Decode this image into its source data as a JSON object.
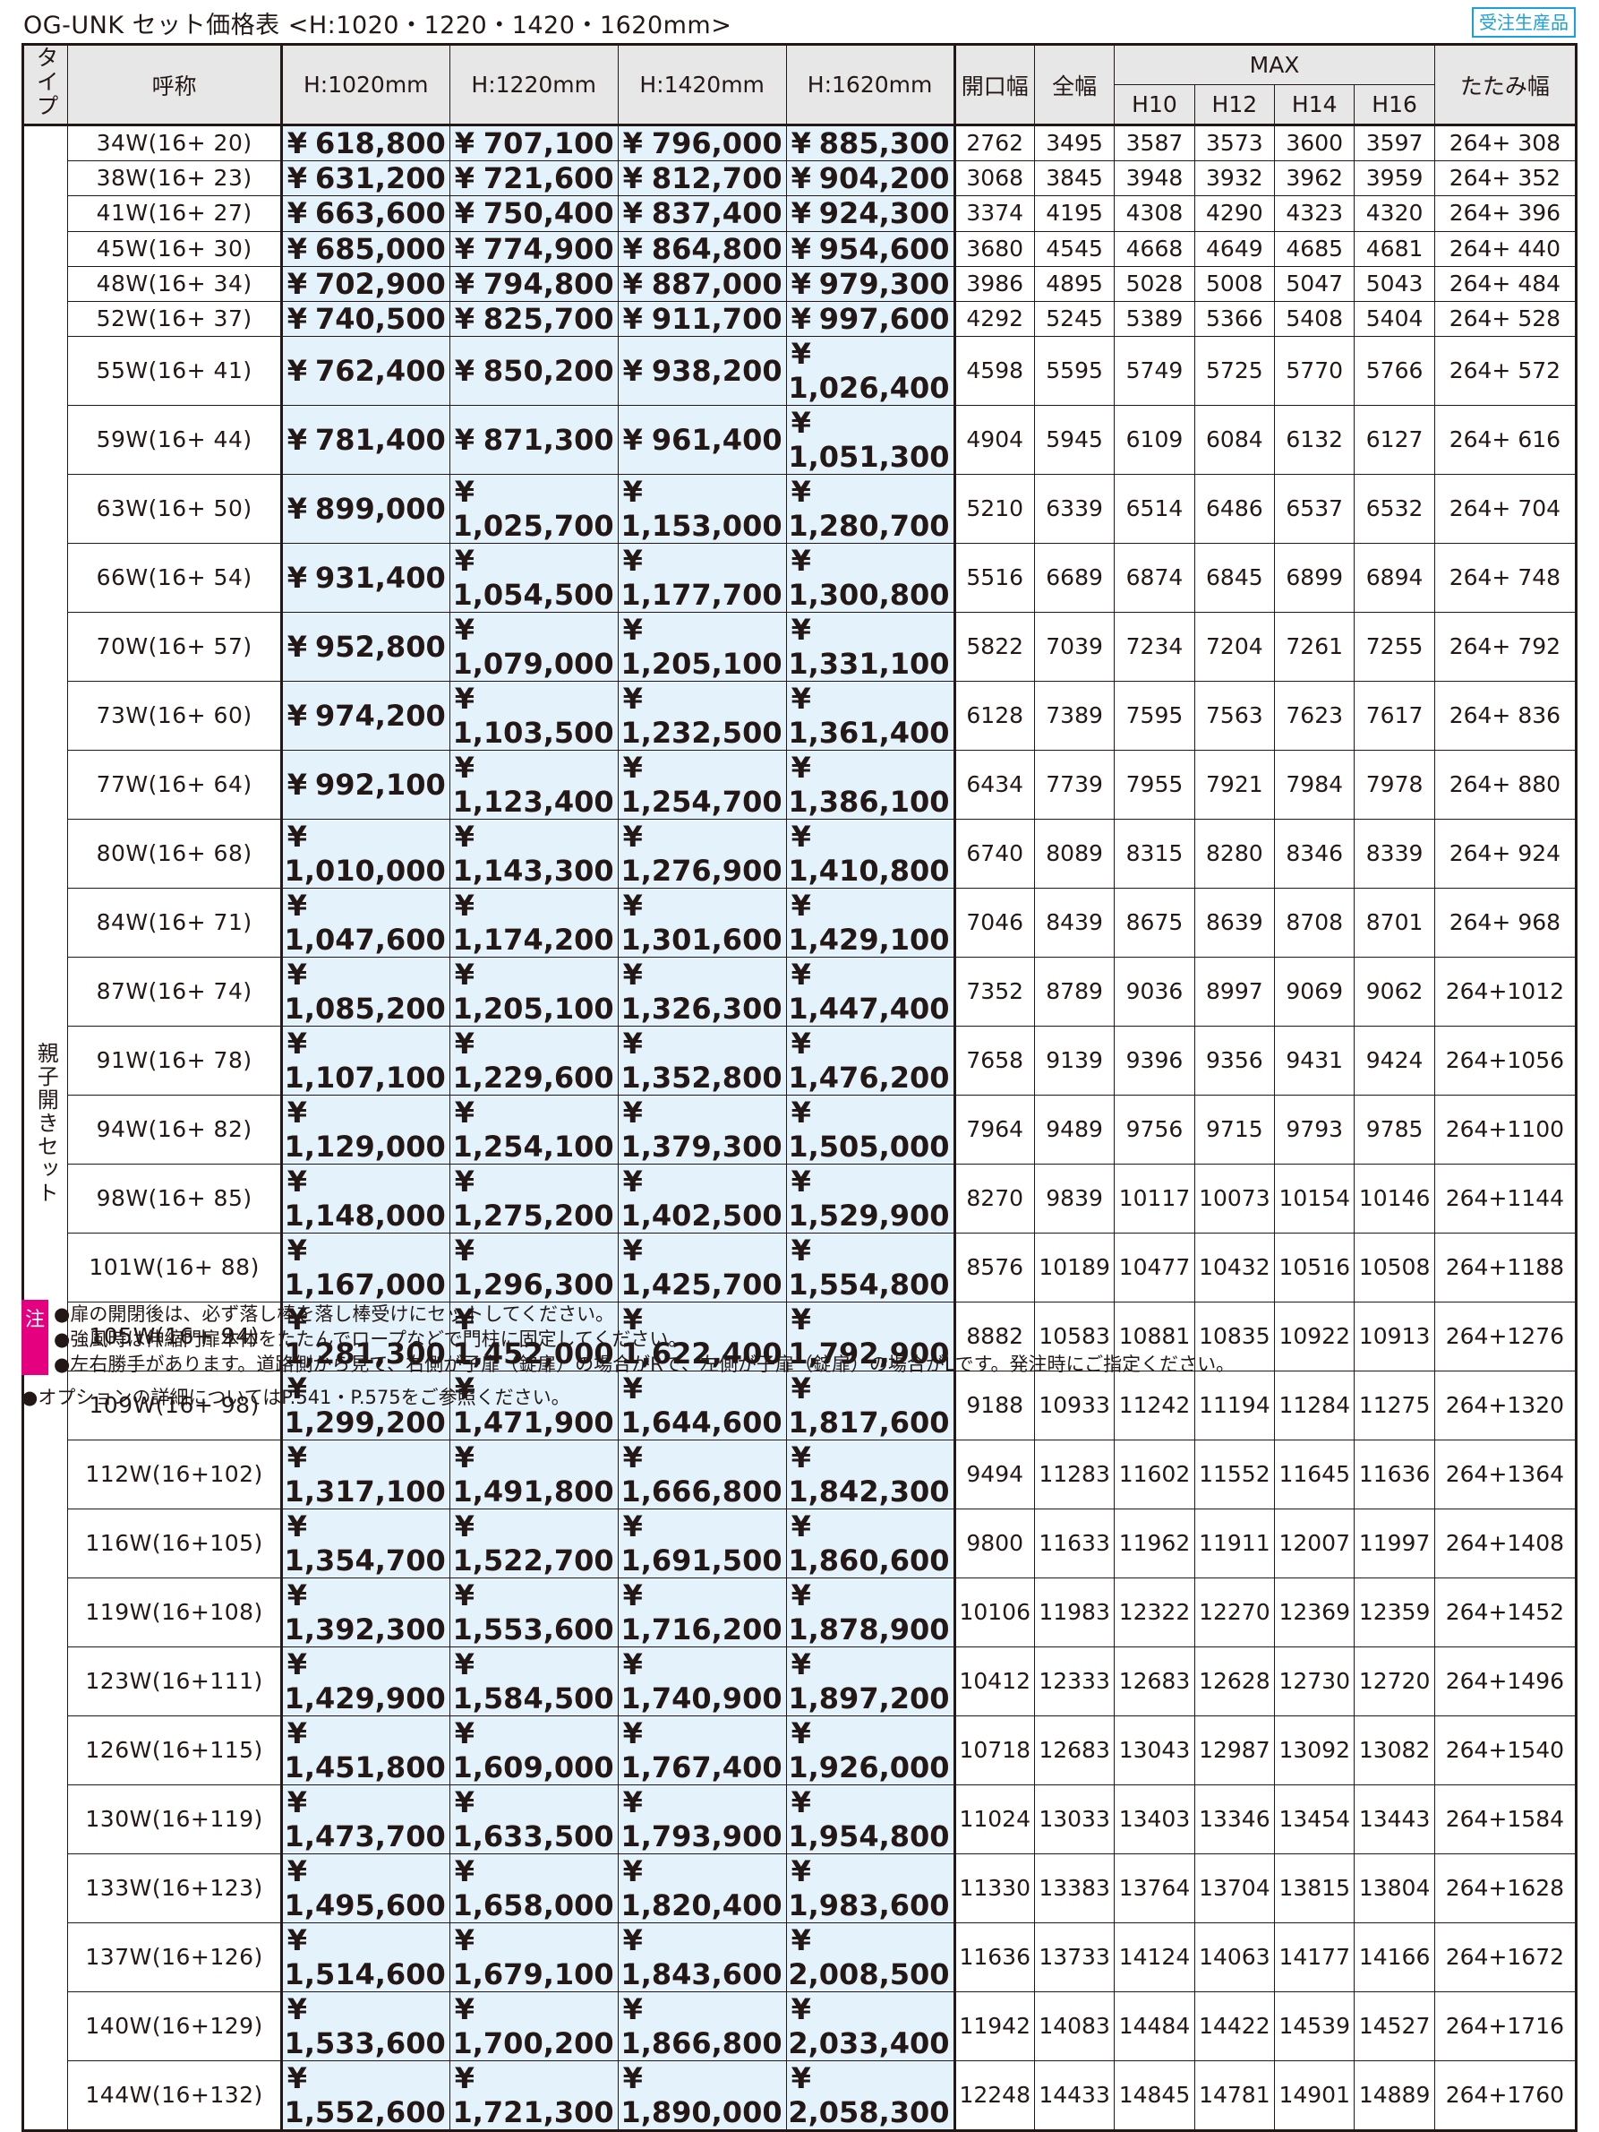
{
  "title": "OG-UNK セット価格表 <H:1020・1220・1420・1620mm>",
  "badge": "受注生産品",
  "headers": {
    "type": "タイプ",
    "name": "呼称",
    "h1020": "H:1020mm",
    "h1220": "H:1220mm",
    "h1420": "H:1420mm",
    "h1620": "H:1620mm",
    "opening": "開口幅",
    "total": "全幅",
    "max": "MAX",
    "max_sub": [
      "H10",
      "H12",
      "H14",
      "H16"
    ],
    "folded": "たたみ幅"
  },
  "type_label": "親子開きセット",
  "yen": "¥",
  "rows": [
    {
      "name": "34W(16+ 20)",
      "prices": [
        "618,800",
        "707,100",
        "796,000",
        "885,300"
      ],
      "opening": "2762",
      "total": "3495",
      "max": [
        "3587",
        "3573",
        "3600",
        "3597"
      ],
      "folded": "264+ 308"
    },
    {
      "name": "38W(16+ 23)",
      "prices": [
        "631,200",
        "721,600",
        "812,700",
        "904,200"
      ],
      "opening": "3068",
      "total": "3845",
      "max": [
        "3948",
        "3932",
        "3962",
        "3959"
      ],
      "folded": "264+ 352"
    },
    {
      "name": "41W(16+ 27)",
      "prices": [
        "663,600",
        "750,400",
        "837,400",
        "924,300"
      ],
      "opening": "3374",
      "total": "4195",
      "max": [
        "4308",
        "4290",
        "4323",
        "4320"
      ],
      "folded": "264+ 396"
    },
    {
      "name": "45W(16+ 30)",
      "prices": [
        "685,000",
        "774,900",
        "864,800",
        "954,600"
      ],
      "opening": "3680",
      "total": "4545",
      "max": [
        "4668",
        "4649",
        "4685",
        "4681"
      ],
      "folded": "264+ 440"
    },
    {
      "name": "48W(16+ 34)",
      "prices": [
        "702,900",
        "794,800",
        "887,000",
        "979,300"
      ],
      "opening": "3986",
      "total": "4895",
      "max": [
        "5028",
        "5008",
        "5047",
        "5043"
      ],
      "folded": "264+ 484"
    },
    {
      "name": "52W(16+ 37)",
      "prices": [
        "740,500",
        "825,700",
        "911,700",
        "997,600"
      ],
      "opening": "4292",
      "total": "5245",
      "max": [
        "5389",
        "5366",
        "5408",
        "5404"
      ],
      "folded": "264+ 528"
    },
    {
      "name": "55W(16+ 41)",
      "prices": [
        "762,400",
        "850,200",
        "938,200",
        "1,026,400"
      ],
      "opening": "4598",
      "total": "5595",
      "max": [
        "5749",
        "5725",
        "5770",
        "5766"
      ],
      "folded": "264+ 572"
    },
    {
      "name": "59W(16+ 44)",
      "prices": [
        "781,400",
        "871,300",
        "961,400",
        "1,051,300"
      ],
      "opening": "4904",
      "total": "5945",
      "max": [
        "6109",
        "6084",
        "6132",
        "6127"
      ],
      "folded": "264+ 616"
    },
    {
      "name": "63W(16+ 50)",
      "prices": [
        "899,000",
        "1,025,700",
        "1,153,000",
        "1,280,700"
      ],
      "opening": "5210",
      "total": "6339",
      "max": [
        "6514",
        "6486",
        "6537",
        "6532"
      ],
      "folded": "264+ 704"
    },
    {
      "name": "66W(16+ 54)",
      "prices": [
        "931,400",
        "1,054,500",
        "1,177,700",
        "1,300,800"
      ],
      "opening": "5516",
      "total": "6689",
      "max": [
        "6874",
        "6845",
        "6899",
        "6894"
      ],
      "folded": "264+ 748"
    },
    {
      "name": "70W(16+ 57)",
      "prices": [
        "952,800",
        "1,079,000",
        "1,205,100",
        "1,331,100"
      ],
      "opening": "5822",
      "total": "7039",
      "max": [
        "7234",
        "7204",
        "7261",
        "7255"
      ],
      "folded": "264+ 792"
    },
    {
      "name": "73W(16+ 60)",
      "prices": [
        "974,200",
        "1,103,500",
        "1,232,500",
        "1,361,400"
      ],
      "opening": "6128",
      "total": "7389",
      "max": [
        "7595",
        "7563",
        "7623",
        "7617"
      ],
      "folded": "264+ 836"
    },
    {
      "name": "77W(16+ 64)",
      "prices": [
        "992,100",
        "1,123,400",
        "1,254,700",
        "1,386,100"
      ],
      "opening": "6434",
      "total": "7739",
      "max": [
        "7955",
        "7921",
        "7984",
        "7978"
      ],
      "folded": "264+ 880"
    },
    {
      "name": "80W(16+ 68)",
      "prices": [
        "1,010,000",
        "1,143,300",
        "1,276,900",
        "1,410,800"
      ],
      "opening": "6740",
      "total": "8089",
      "max": [
        "8315",
        "8280",
        "8346",
        "8339"
      ],
      "folded": "264+ 924"
    },
    {
      "name": "84W(16+ 71)",
      "prices": [
        "1,047,600",
        "1,174,200",
        "1,301,600",
        "1,429,100"
      ],
      "opening": "7046",
      "total": "8439",
      "max": [
        "8675",
        "8639",
        "8708",
        "8701"
      ],
      "folded": "264+ 968"
    },
    {
      "name": "87W(16+ 74)",
      "prices": [
        "1,085,200",
        "1,205,100",
        "1,326,300",
        "1,447,400"
      ],
      "opening": "7352",
      "total": "8789",
      "max": [
        "9036",
        "8997",
        "9069",
        "9062"
      ],
      "folded": "264+1012"
    },
    {
      "name": "91W(16+ 78)",
      "prices": [
        "1,107,100",
        "1,229,600",
        "1,352,800",
        "1,476,200"
      ],
      "opening": "7658",
      "total": "9139",
      "max": [
        "9396",
        "9356",
        "9431",
        "9424"
      ],
      "folded": "264+1056"
    },
    {
      "name": "94W(16+ 82)",
      "prices": [
        "1,129,000",
        "1,254,100",
        "1,379,300",
        "1,505,000"
      ],
      "opening": "7964",
      "total": "9489",
      "max": [
        "9756",
        "9715",
        "9793",
        "9785"
      ],
      "folded": "264+1100"
    },
    {
      "name": "98W(16+ 85)",
      "prices": [
        "1,148,000",
        "1,275,200",
        "1,402,500",
        "1,529,900"
      ],
      "opening": "8270",
      "total": "9839",
      "max": [
        "10117",
        "10073",
        "10154",
        "10146"
      ],
      "folded": "264+1144"
    },
    {
      "name": "101W(16+ 88)",
      "prices": [
        "1,167,000",
        "1,296,300",
        "1,425,700",
        "1,554,800"
      ],
      "opening": "8576",
      "total": "10189",
      "max": [
        "10477",
        "10432",
        "10516",
        "10508"
      ],
      "folded": "264+1188"
    },
    {
      "name": "105W(16+ 94)",
      "prices": [
        "1,281,300",
        "1,452,000",
        "1,622,400",
        "1,792,900"
      ],
      "opening": "8882",
      "total": "10583",
      "max": [
        "10881",
        "10835",
        "10922",
        "10913"
      ],
      "folded": "264+1276"
    },
    {
      "name": "109W(16+ 98)",
      "prices": [
        "1,299,200",
        "1,471,900",
        "1,644,600",
        "1,817,600"
      ],
      "opening": "9188",
      "total": "10933",
      "max": [
        "11242",
        "11194",
        "11284",
        "11275"
      ],
      "folded": "264+1320"
    },
    {
      "name": "112W(16+102)",
      "prices": [
        "1,317,100",
        "1,491,800",
        "1,666,800",
        "1,842,300"
      ],
      "opening": "9494",
      "total": "11283",
      "max": [
        "11602",
        "11552",
        "11645",
        "11636"
      ],
      "folded": "264+1364"
    },
    {
      "name": "116W(16+105)",
      "prices": [
        "1,354,700",
        "1,522,700",
        "1,691,500",
        "1,860,600"
      ],
      "opening": "9800",
      "total": "11633",
      "max": [
        "11962",
        "11911",
        "12007",
        "11997"
      ],
      "folded": "264+1408"
    },
    {
      "name": "119W(16+108)",
      "prices": [
        "1,392,300",
        "1,553,600",
        "1,716,200",
        "1,878,900"
      ],
      "opening": "10106",
      "total": "11983",
      "max": [
        "12322",
        "12270",
        "12369",
        "12359"
      ],
      "folded": "264+1452"
    },
    {
      "name": "123W(16+111)",
      "prices": [
        "1,429,900",
        "1,584,500",
        "1,740,900",
        "1,897,200"
      ],
      "opening": "10412",
      "total": "12333",
      "max": [
        "12683",
        "12628",
        "12730",
        "12720"
      ],
      "folded": "264+1496"
    },
    {
      "name": "126W(16+115)",
      "prices": [
        "1,451,800",
        "1,609,000",
        "1,767,400",
        "1,926,000"
      ],
      "opening": "10718",
      "total": "12683",
      "max": [
        "13043",
        "12987",
        "13092",
        "13082"
      ],
      "folded": "264+1540"
    },
    {
      "name": "130W(16+119)",
      "prices": [
        "1,473,700",
        "1,633,500",
        "1,793,900",
        "1,954,800"
      ],
      "opening": "11024",
      "total": "13033",
      "max": [
        "13403",
        "13346",
        "13454",
        "13443"
      ],
      "folded": "264+1584"
    },
    {
      "name": "133W(16+123)",
      "prices": [
        "1,495,600",
        "1,658,000",
        "1,820,400",
        "1,983,600"
      ],
      "opening": "11330",
      "total": "13383",
      "max": [
        "13764",
        "13704",
        "13815",
        "13804"
      ],
      "folded": "264+1628"
    },
    {
      "name": "137W(16+126)",
      "prices": [
        "1,514,600",
        "1,679,100",
        "1,843,600",
        "2,008,500"
      ],
      "opening": "11636",
      "total": "13733",
      "max": [
        "14124",
        "14063",
        "14177",
        "14166"
      ],
      "folded": "264+1672"
    },
    {
      "name": "140W(16+129)",
      "prices": [
        "1,533,600",
        "1,700,200",
        "1,866,800",
        "2,033,400"
      ],
      "opening": "11942",
      "total": "14083",
      "max": [
        "14484",
        "14422",
        "14539",
        "14527"
      ],
      "folded": "264+1716"
    },
    {
      "name": "144W(16+132)",
      "prices": [
        "1,552,600",
        "1,721,300",
        "1,890,000",
        "2,058,300"
      ],
      "opening": "12248",
      "total": "14433",
      "max": [
        "14845",
        "14781",
        "14901",
        "14889"
      ],
      "folded": "264+1760"
    }
  ],
  "note_label": "注",
  "notes": [
    "●扉の開閉後は、必ず落し棒を落し棒受けにセットしてください。",
    "●強風時は伸縮門扉本体をたたんでロープなどで門柱に固定してください。",
    "●左右勝手があります。道路側から見て、右側が子扉（錠扉）の場合がRで、左側が子扉（錠扉）の場合がLです。発注時にご指定ください。"
  ],
  "option_note": "●オプションの詳細についてはP.541・P.575をご参照ください。",
  "colors": {
    "price_bg": "#e4f3fb",
    "header_bg": "#e7e7e7",
    "badge": "#1aa0dc",
    "note_label": "#e5007f"
  }
}
